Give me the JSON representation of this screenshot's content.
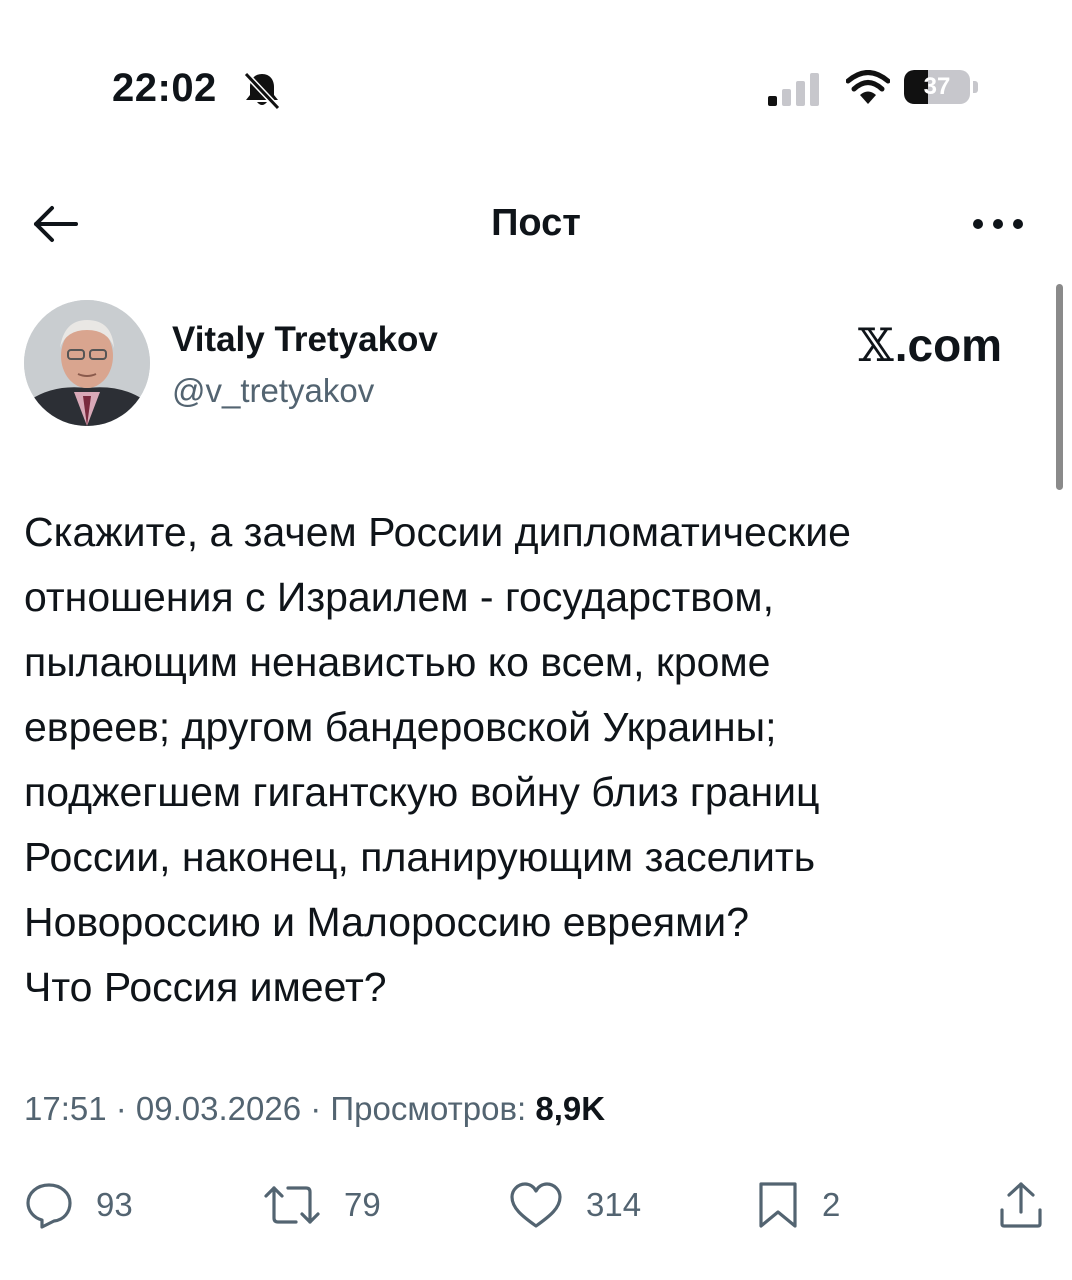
{
  "status_bar": {
    "time": "22:02",
    "battery_level": "37",
    "icons": [
      "bell-slash-icon",
      "cellular-signal-icon",
      "wifi-icon",
      "battery-icon"
    ]
  },
  "header": {
    "title": "Пост",
    "back_icon": "arrow-left-icon",
    "more_icon": "more-horizontal-icon"
  },
  "author": {
    "name": "Vitaly Tretyakov",
    "handle": "@v_tretyakov",
    "brand_x": "𝕏",
    "brand_domain": ".com"
  },
  "post": {
    "lines": [
      "Скажите, а зачем России дипломатические",
      "отношения с Израилем - государством,",
      "пылающим ненавистью ко всем, кроме",
      "евреев; другом бандеровской Украины;",
      "поджегшем гигантскую войну близ границ",
      "России, наконец, планирующим заселить",
      "Новороссию и Малороссию евреями?",
      "Что Россия имеет?"
    ]
  },
  "meta": {
    "time": "17:51",
    "separator": " · ",
    "date": "09.03.2026",
    "views_label": "Просмотров: ",
    "views_count": "8,9K"
  },
  "actions": {
    "replies": "93",
    "reposts": "79",
    "likes": "314",
    "bookmarks": "2",
    "icons": [
      "reply-icon",
      "repost-icon",
      "like-icon",
      "bookmark-icon",
      "share-icon"
    ]
  },
  "colors": {
    "text": "#0f1419",
    "secondary": "#536471",
    "background": "#ffffff"
  }
}
